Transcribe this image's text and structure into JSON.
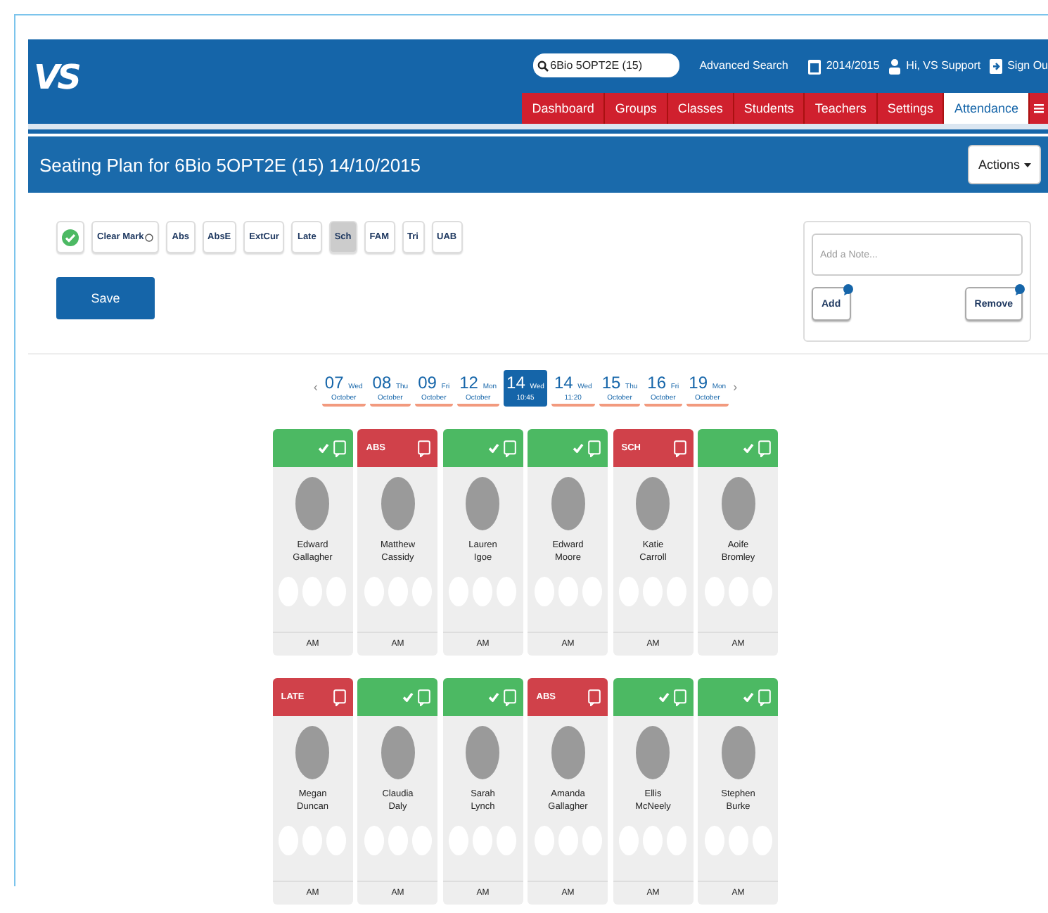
{
  "header": {
    "logo": "VS",
    "search": {
      "value": "6Bio 5OPT2E (15)"
    },
    "links": [
      {
        "kind": "text",
        "label": "Advanced Search"
      },
      {
        "kind": "calendar",
        "label": "2014/2015"
      },
      {
        "kind": "user",
        "label": "Hi, VS Support"
      },
      {
        "kind": "signout",
        "label": "Sign Ou"
      }
    ],
    "tabs": [
      {
        "label": "Dashboard",
        "selected": false
      },
      {
        "label": "Groups",
        "selected": false
      },
      {
        "label": "Classes",
        "selected": false
      },
      {
        "label": "Students",
        "selected": false
      },
      {
        "label": "Teachers",
        "selected": false
      },
      {
        "label": "Settings",
        "selected": false
      },
      {
        "label": "Attendance",
        "selected": true
      }
    ]
  },
  "title_bar": {
    "title": "Seating Plan for 6Bio 5OPT2E (15) 14/10/2015",
    "actions": "Actions"
  },
  "marks": [
    {
      "kind": "tick",
      "selected": false
    },
    {
      "kind": "clear",
      "label": "Clear Mark",
      "selected": false
    },
    {
      "kind": "text",
      "label": "Abs",
      "selected": false
    },
    {
      "kind": "text",
      "label": "AbsE",
      "selected": false
    },
    {
      "kind": "text",
      "label": "ExtCur",
      "selected": false
    },
    {
      "kind": "text",
      "label": "Late",
      "selected": false
    },
    {
      "kind": "text",
      "label": "Sch",
      "selected": true
    },
    {
      "kind": "text",
      "label": "FAM",
      "selected": false
    },
    {
      "kind": "text",
      "label": "Tri",
      "selected": false
    },
    {
      "kind": "text",
      "label": "UAB",
      "selected": false
    }
  ],
  "save": "Save",
  "note": {
    "placeholder": "Add a Note...",
    "add": "Add",
    "remove": "Remove"
  },
  "date_nav": {
    "previous": "‹",
    "next": "›"
  },
  "dates": [
    {
      "day": "07",
      "weekday": "Wed",
      "sub": "October",
      "selected": false
    },
    {
      "day": "08",
      "weekday": "Thu",
      "sub": "October",
      "selected": false
    },
    {
      "day": "09",
      "weekday": "Fri",
      "sub": "October",
      "selected": false
    },
    {
      "day": "12",
      "weekday": "Mon",
      "sub": "October",
      "selected": false
    },
    {
      "day": "14",
      "weekday": "Wed",
      "sub": "10:45",
      "selected": true
    },
    {
      "day": "14",
      "weekday": "Wed",
      "sub": "11:20",
      "selected": false
    },
    {
      "day": "15",
      "weekday": "Thu",
      "sub": "October",
      "selected": false
    },
    {
      "day": "16",
      "weekday": "Fri",
      "sub": "October",
      "selected": false
    },
    {
      "day": "19",
      "weekday": "Mon",
      "sub": "October",
      "selected": false
    }
  ],
  "students": [
    {
      "first": "Edward",
      "last": "Gallagher",
      "present": true,
      "session": "AM"
    },
    {
      "first": "Matthew",
      "last": "Cassidy",
      "present": false,
      "code": "ABS",
      "session": "AM"
    },
    {
      "first": "Lauren",
      "last": "Igoe",
      "present": true,
      "session": "AM"
    },
    {
      "first": "Edward",
      "last": "Moore",
      "present": true,
      "session": "AM"
    },
    {
      "first": "Katie",
      "last": "Carroll",
      "present": false,
      "code": "SCH",
      "session": "AM"
    },
    {
      "first": "Aoife",
      "last": "Bromley",
      "present": true,
      "session": "AM"
    },
    {
      "first": "Megan",
      "last": "Duncan",
      "present": false,
      "code": "LATE",
      "session": "AM"
    },
    {
      "first": "Claudia",
      "last": "Daly",
      "present": true,
      "session": "AM"
    },
    {
      "first": "Sarah",
      "last": "Lynch",
      "present": true,
      "session": "AM"
    },
    {
      "first": "Amanda",
      "last": "Gallagher",
      "present": false,
      "code": "ABS",
      "session": "AM"
    },
    {
      "first": "Ellis",
      "last": "McNeely",
      "present": true,
      "session": "AM"
    },
    {
      "first": "Stephen",
      "last": "Burke",
      "present": true,
      "session": "AM"
    }
  ]
}
